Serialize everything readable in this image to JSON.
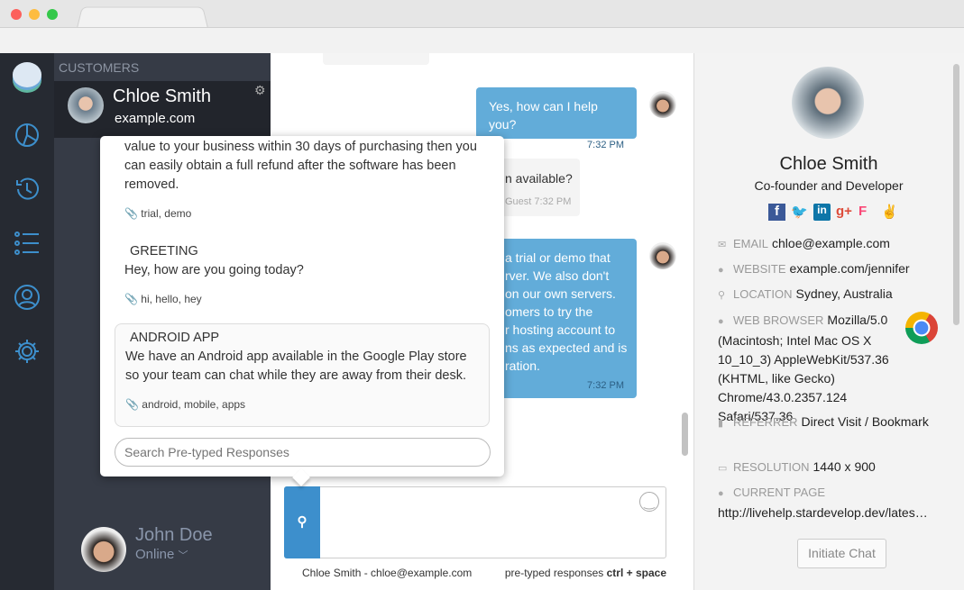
{
  "sidebar": {
    "icons": [
      "logo-bubble-icon",
      "pie-chart-icon",
      "history-icon",
      "list-icon",
      "user-icon",
      "gear-icon"
    ]
  },
  "customers": {
    "header": "CUSTOMERS",
    "selected": {
      "name": "Chloe Smith",
      "site": "example.com"
    }
  },
  "agent": {
    "name": "John Doe",
    "status": "Online"
  },
  "messages": [
    {
      "from": "agent",
      "text": "Yes, how can I help you?",
      "time": "7:32 PM"
    },
    {
      "from": "guest",
      "text": "n available?",
      "meta": "Guest 7:32 PM"
    },
    {
      "from": "agent",
      "lines": [
        "a trial or demo that",
        "rver. We also don't",
        "on our own servers.",
        "omers to try the",
        "r hosting account to",
        "ns as expected and is",
        "ration."
      ],
      "time": "7:32 PM"
    }
  ],
  "pretyped": {
    "items": [
      {
        "title": "",
        "text": "value to your business within 30 days of purchasing then you can easily obtain a full refund after the software has been removed.",
        "tags": "trial, demo"
      },
      {
        "title": "GREETING",
        "text": "Hey, how are you going today?",
        "tags": "hi, hello, hey"
      },
      {
        "title": "ANDROID APP",
        "text": "We have an Android app available in the Google Play store so your team can chat while they are away from their desk.",
        "tags": "android, mobile, apps"
      }
    ],
    "search_placeholder": "Search Pre-typed Responses"
  },
  "composer": {
    "footer_left": "Chloe Smith - chloe@example.com",
    "footer_right": "pre-typed responses",
    "shortcut": "ctrl + space"
  },
  "profile": {
    "name": "Chloe Smith",
    "role": "Co-founder and Developer",
    "social": [
      "facebook",
      "twitter",
      "linkedin",
      "google-plus",
      "foursquare",
      "angellist"
    ],
    "email_label": "EMAIL",
    "email": "chloe@example.com",
    "website_label": "WEBSITE",
    "website": "example.com/jennifer",
    "location_label": "LOCATION",
    "location": "Sydney, Australia",
    "browser_label": "WEB BROWSER",
    "browser": "Mozilla/5.0 (Macintosh; Intel Mac OS X 10_10_3) AppleWebKit/537.36 (KHTML, like Gecko) Chrome/43.0.2357.124 Safari/537.36",
    "referrer_label": "REFERRER",
    "referrer": "Direct Visit / Bookmark",
    "resolution_label": "RESOLUTION",
    "resolution": "1440 x 900",
    "page_label": "CURRENT PAGE",
    "page": "http://livehelp.stardevelop.dev/lates…",
    "initiate": "Initiate Chat"
  },
  "colors": {
    "accent": "#3d8fcc",
    "bubble": "#62acd9",
    "rail": "#262a32",
    "panel": "#363b46"
  }
}
